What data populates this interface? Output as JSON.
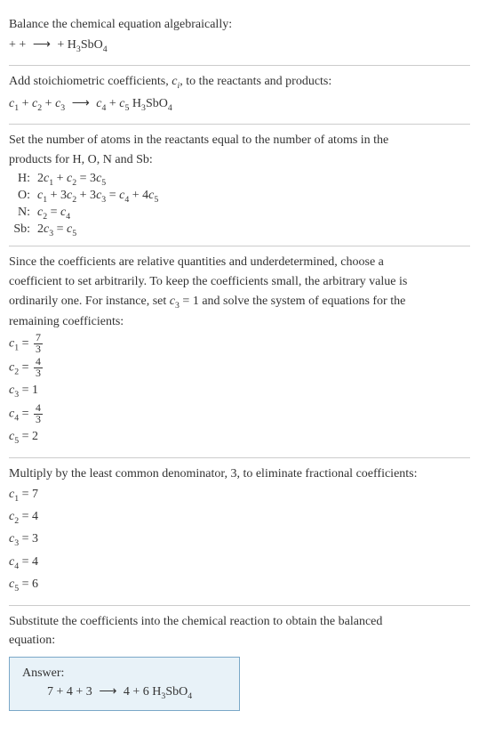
{
  "section1": {
    "line1": "Balance the chemical equation algebraically:",
    "plus1": " + ",
    "plus2": " + ",
    "arrow": "⟶",
    "plus3": " + H",
    "sub3": "3",
    "sbopart": "SbO",
    "sub4": "4"
  },
  "section2": {
    "line1_a": "Add stoichiometric coefficients, ",
    "line1_c": "c",
    "line1_i": "i",
    "line1_b": ", to the reactants and products:",
    "c1": "c",
    "s1": "1",
    "plus1": " + ",
    "c2": "c",
    "s2": "2",
    "plus2": " + ",
    "c3": "c",
    "s3": "3",
    "arrow": "⟶",
    "c4": "c",
    "s4": "4",
    "plus3": " + ",
    "c5": "c",
    "s5": "5",
    "h3sbo4_h": " H",
    "h3sbo4_3": "3",
    "h3sbo4_sbo": "SbO",
    "h3sbo4_4": "4"
  },
  "section3": {
    "intro1": "Set the number of atoms in the reactants equal to the number of atoms in the",
    "intro2": "products for H, O, N and Sb:",
    "rows": {
      "H": {
        "label": "H:",
        "lhs_a": "2",
        "c1": "c",
        "s1": "1",
        "plus": " + ",
        "c2": "c",
        "s2": "2",
        "eq": " = 3",
        "c5": "c",
        "s5": "5"
      },
      "O": {
        "label": "O:",
        "c1": "c",
        "s1": "1",
        "plus1": " + 3",
        "c2": "c",
        "s2": "2",
        "plus2": " + 3",
        "c3": "c",
        "s3": "3",
        "eq": " = ",
        "c4": "c",
        "s4": "4",
        "plus3": " + 4",
        "c5": "c",
        "s5": "5"
      },
      "N": {
        "label": "N:",
        "c2": "c",
        "s2": "2",
        "eq": " = ",
        "c4": "c",
        "s4": "4"
      },
      "Sb": {
        "label": "Sb:",
        "two": "2",
        "c3": "c",
        "s3": "3",
        "eq": " = ",
        "c5": "c",
        "s5": "5"
      }
    }
  },
  "section4": {
    "line1": "Since the coefficients are relative quantities and underdetermined, choose a",
    "line2": "coefficient to set arbitrarily. To keep the coefficients small, the arbitrary value is",
    "line3_a": "ordinarily one. For instance, set ",
    "line3_c": "c",
    "line3_3": "3",
    "line3_b": " = 1 and solve the system of equations for the",
    "line4": "remaining coefficients:",
    "c1": {
      "var": "c",
      "sub": "1",
      "eq": " = ",
      "num": "7",
      "den": "3"
    },
    "c2": {
      "var": "c",
      "sub": "2",
      "eq": " = ",
      "num": "4",
      "den": "3"
    },
    "c3": {
      "var": "c",
      "sub": "3",
      "eq": " = 1"
    },
    "c4": {
      "var": "c",
      "sub": "4",
      "eq": " = ",
      "num": "4",
      "den": "3"
    },
    "c5": {
      "var": "c",
      "sub": "5",
      "eq": " = 2"
    }
  },
  "section5": {
    "line1": "Multiply by the least common denominator, 3, to eliminate fractional coefficients:",
    "c1": {
      "var": "c",
      "sub": "1",
      "eq": " = 7"
    },
    "c2": {
      "var": "c",
      "sub": "2",
      "eq": " = 4"
    },
    "c3": {
      "var": "c",
      "sub": "3",
      "eq": " = 3"
    },
    "c4": {
      "var": "c",
      "sub": "4",
      "eq": " = 4"
    },
    "c5": {
      "var": "c",
      "sub": "5",
      "eq": " = 6"
    }
  },
  "section6": {
    "line1": "Substitute the coefficients into the chemical reaction to obtain the balanced",
    "line2": "equation:",
    "answer_label": "Answer:",
    "eq": {
      "n7": "7 ",
      "plus1": " + 4 ",
      "plus2": " + 3 ",
      "arrow": "⟶",
      "n4": " 4 ",
      "plus3": " + 6 H",
      "sub3": "3",
      "sbo": "SbO",
      "sub4": "4"
    }
  }
}
